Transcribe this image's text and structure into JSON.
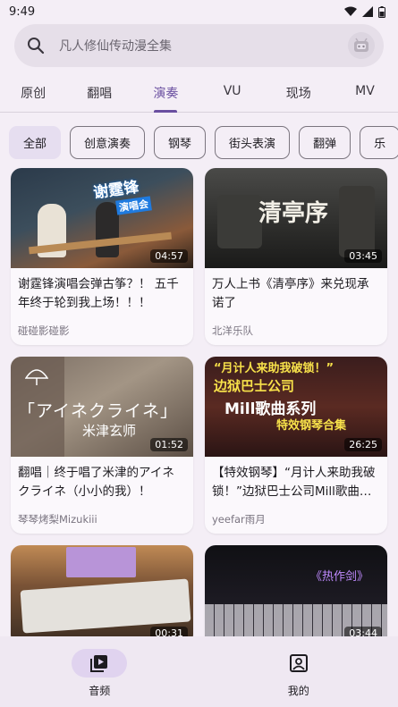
{
  "status": {
    "time": "9:49"
  },
  "search": {
    "placeholder": "凡人修仙传动漫全集"
  },
  "tabs": [
    {
      "label": "原创",
      "active": false
    },
    {
      "label": "翻唱",
      "active": false
    },
    {
      "label": "演奏",
      "active": true
    },
    {
      "label": "VU",
      "active": false
    },
    {
      "label": "现场",
      "active": false
    },
    {
      "label": "MV",
      "active": false
    }
  ],
  "chips": [
    {
      "label": "全部",
      "selected": true
    },
    {
      "label": "创意演奏",
      "selected": false
    },
    {
      "label": "钢琴",
      "selected": false
    },
    {
      "label": "街头表演",
      "selected": false
    },
    {
      "label": "翻弹",
      "selected": false
    },
    {
      "label": "乐",
      "selected": false
    }
  ],
  "videos": [
    {
      "title": "谢霆锋演唱会弹古筝？！ 五千年终于轮到我上场！！！",
      "author": "碰碰影碰影",
      "duration": "04:57",
      "thumb_text": "谢霆锋",
      "thumb_subtext": "演唱会"
    },
    {
      "title": "万人上书《清亭序》来兑现承诺了",
      "author": "北洋乐队",
      "duration": "03:45",
      "thumb_text": "清亭序",
      "thumb_subtext": ""
    },
    {
      "title": "翻唱｜终于唱了米津的アイネクライネ（小小的我）！",
      "author": "琴琴烤梨Mizukiii",
      "duration": "01:52",
      "thumb_text": "「アイネクライネ」",
      "thumb_subtext": "米津玄师"
    },
    {
      "title": "【特效钢琴】“月计人来助我破锁！”边狱巴士公司Mill歌曲…",
      "author": "yeefar雨月",
      "duration": "26:25",
      "thumb_text": "“月计人来助我破锁！”",
      "thumb_subtext": "边狱巴士公司",
      "thumb_line3": "Mill歌曲系列",
      "thumb_line4": "特效钢琴合集"
    },
    {
      "title": "",
      "author": "",
      "duration": "00:31",
      "thumb_text": "",
      "thumb_subtext": ""
    },
    {
      "title": "",
      "author": "",
      "duration": "03:44",
      "thumb_text": "《热作剑》",
      "thumb_subtext": ""
    }
  ],
  "nav": [
    {
      "label": "音频",
      "icon": "play-library-icon",
      "active": true
    },
    {
      "label": "我的",
      "icon": "profile-icon",
      "active": false
    }
  ],
  "colors": {
    "accent": "#6a4fa0",
    "background": "#f4eef6"
  }
}
